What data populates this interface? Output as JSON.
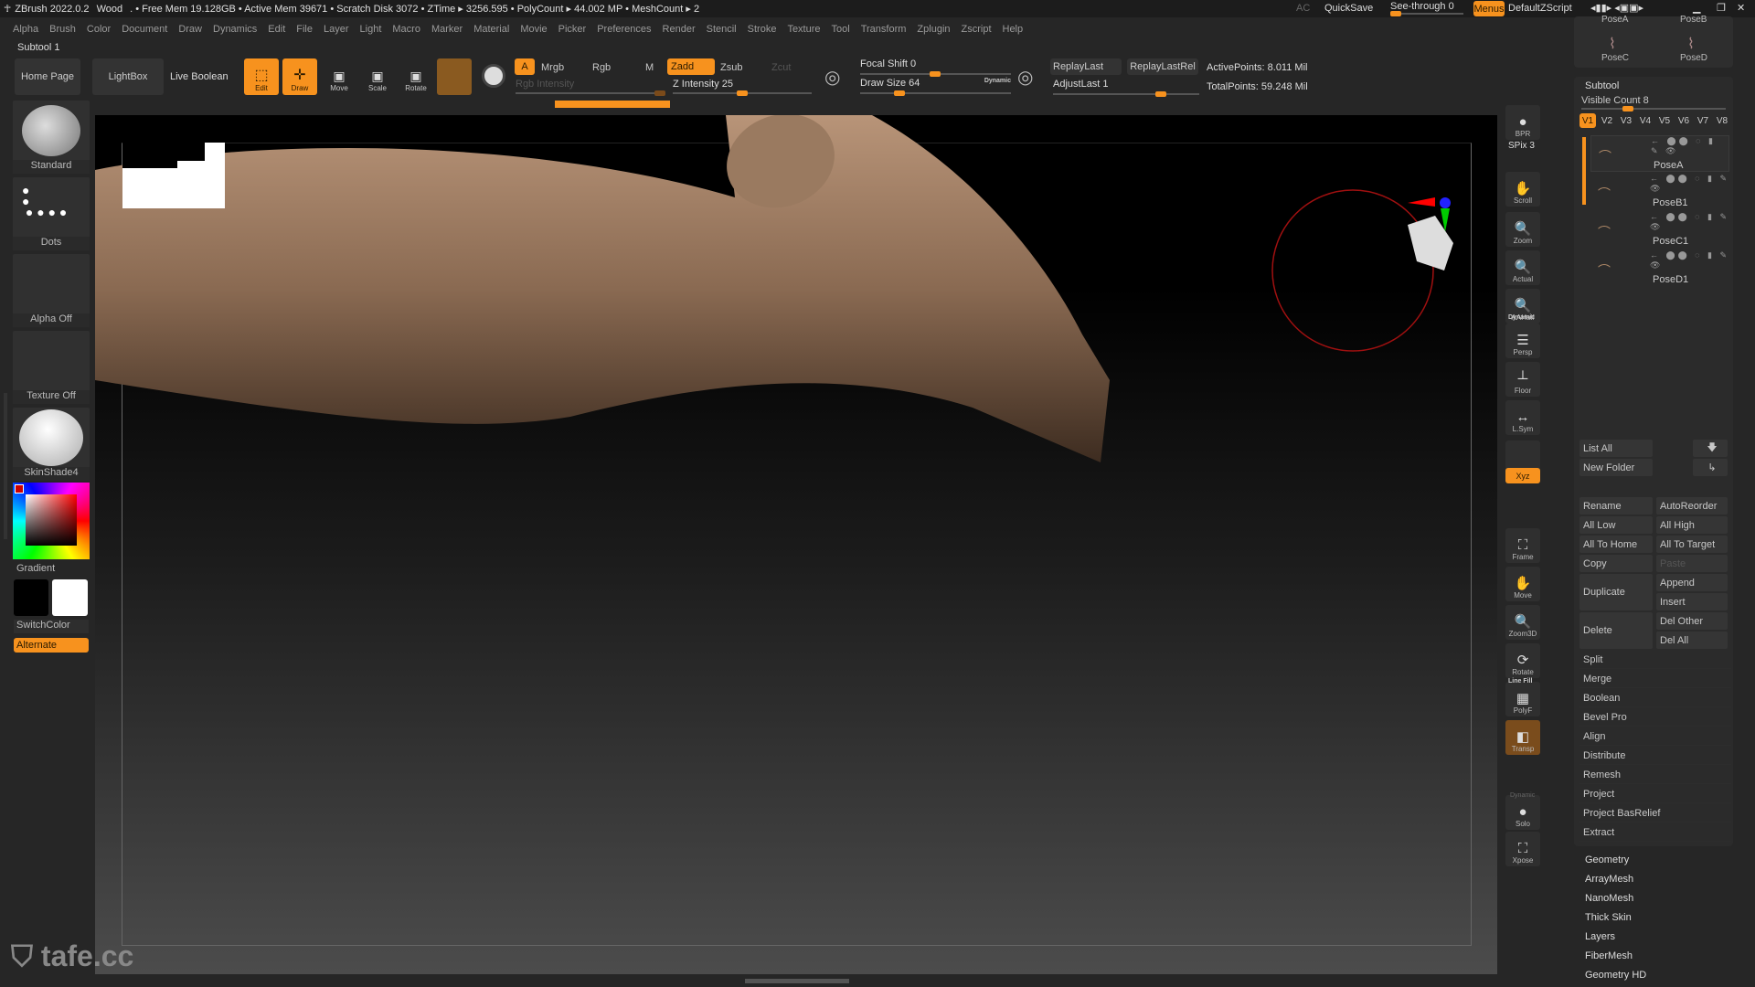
{
  "titlebar": {
    "app": "ZBrush 2022.0.2",
    "doc": "Wood",
    "stats": ". • Free Mem 19.128GB • Active Mem 39671 • Scratch Disk 3072 • ZTime ▸ 3256.595 • PolyCount ▸ 44.002 MP • MeshCount ▸ 2",
    "ac": "AC",
    "quicksave": "QuickSave",
    "see_through": "See-through  0",
    "menus": "Menus",
    "script": "DefaultZScript"
  },
  "menus": [
    "Alpha",
    "Brush",
    "Color",
    "Document",
    "Draw",
    "Dynamics",
    "Edit",
    "File",
    "Layer",
    "Light",
    "Macro",
    "Marker",
    "Material",
    "Movie",
    "Picker",
    "Preferences",
    "Render",
    "Stencil",
    "Stroke",
    "Texture",
    "Tool",
    "Transform",
    "Zplugin",
    "Zscript",
    "Help"
  ],
  "subtool_label": "Subtool 1",
  "toolbar": {
    "home": "Home Page",
    "lightbox": "LightBox",
    "live_boolean": "Live Boolean",
    "edit": "Edit",
    "draw": "Draw",
    "move": "Move",
    "scale": "Scale",
    "rotate": "Rotate",
    "a": "A",
    "mrgb": "Mrgb",
    "rgb": "Rgb",
    "m": "M",
    "zadd": "Zadd",
    "zsub": "Zsub",
    "zcut": "Zcut",
    "rgb_intensity": "Rgb Intensity",
    "z_intensity": "Z Intensity 25",
    "focal_shift": "Focal Shift 0",
    "draw_size": "Draw Size 64",
    "dynamic": "Dynamic",
    "replay_last": "ReplayLast",
    "replay_last_rel": "ReplayLastRel",
    "adjust_last": "AdjustLast 1",
    "active_points": "ActivePoints: 8.011 Mil",
    "total_points": "TotalPoints: 59.248 Mil",
    "z_intensity_value": 25,
    "focal_shift_value": 0,
    "draw_size_value": 64
  },
  "left_shelf": {
    "brush": "Standard",
    "stroke": "Dots",
    "alpha": "Alpha Off",
    "texture": "Texture Off",
    "material": "SkinShade4",
    "gradient": "Gradient",
    "switch_color": "SwitchColor",
    "alternate": "Alternate"
  },
  "right_tools": [
    "BPR",
    "SPix 3",
    "Scroll",
    "Zoom",
    "Actual",
    "AAHalf",
    "Persp",
    "Floor",
    "L.Sym",
    "",
    "Xyz",
    "",
    "",
    "Frame",
    "Move",
    "Zoom3D",
    "Rotate",
    "PolyF",
    "Transp",
    "",
    "Solo",
    "Xpose"
  ],
  "right_tools_extra": {
    "dynamic": "Dynamic",
    "line_fill": "Line Fill",
    "dynamic2": "Dynamic"
  },
  "poses": [
    "PoseA",
    "PoseB",
    "PoseC",
    "PoseD"
  ],
  "subtool": {
    "title": "Subtool",
    "visible_count": "Visible Count 8",
    "visible_count_value": 8,
    "versions": [
      "V1",
      "V2",
      "V3",
      "V4",
      "V5",
      "V6",
      "V7",
      "V8"
    ],
    "active_version": "V1",
    "items": [
      "PoseA",
      "PoseB1",
      "PoseC1",
      "PoseD1"
    ],
    "list_all": "List All",
    "new_folder": "New Folder",
    "grid": [
      [
        "Rename",
        "AutoReorder"
      ],
      [
        "All Low",
        "All High"
      ],
      [
        "All To Home",
        "All To Target"
      ],
      [
        "Copy",
        "Paste"
      ]
    ],
    "duplicate": "Duplicate",
    "append": "Append",
    "insert": "Insert",
    "delete": "Delete",
    "del_other": "Del Other",
    "del_all": "Del All",
    "list": [
      "Split",
      "Merge",
      "Boolean",
      "Bevel Pro",
      "Align",
      "Distribute",
      "Remesh",
      "Project",
      "Project BasRelief",
      "Extract"
    ]
  },
  "tool_sections": [
    "Geometry",
    "ArrayMesh",
    "NanoMesh",
    "Thick Skin",
    "Layers",
    "FiberMesh",
    "Geometry HD"
  ],
  "watermark": "tafe.cc",
  "colors": {
    "accent": "#f7921e",
    "bg": "#262626"
  }
}
